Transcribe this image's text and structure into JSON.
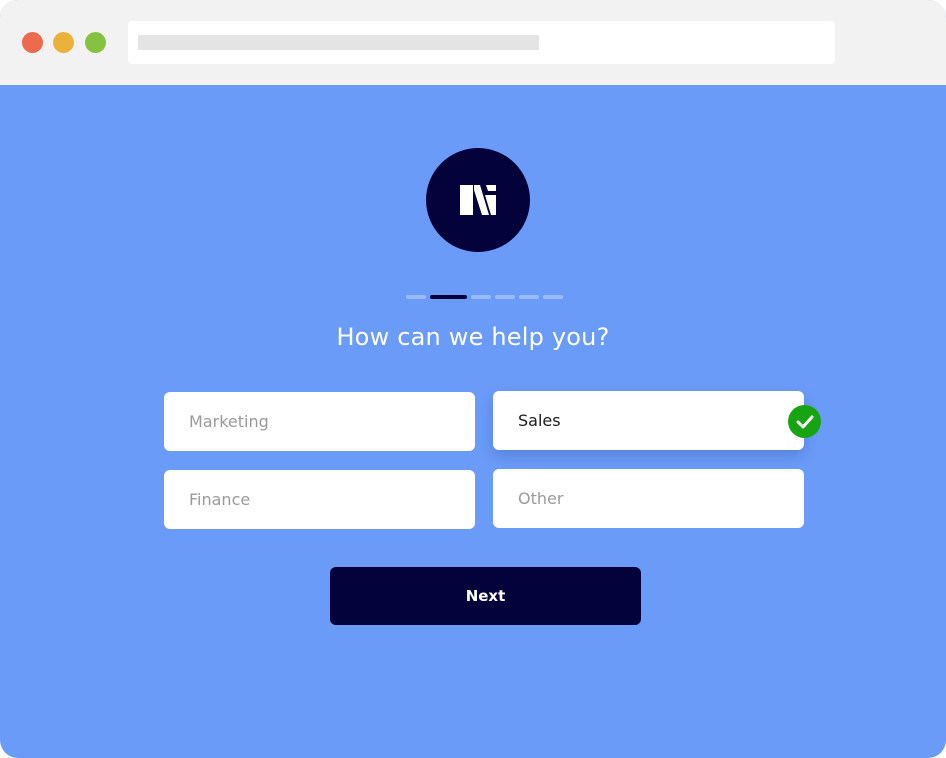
{
  "browser": {
    "controls": [
      "close",
      "minimize",
      "maximize"
    ],
    "address_bar": ""
  },
  "logo": {
    "icon": "n-logo-icon"
  },
  "progress": {
    "total_steps": 6,
    "current_step": 2
  },
  "question": "How can we help you?",
  "options": [
    {
      "label": "Marketing",
      "selected": false
    },
    {
      "label": "Sales",
      "selected": true
    },
    {
      "label": "Finance",
      "selected": false
    },
    {
      "label": "Other",
      "selected": false
    }
  ],
  "next_label": "Next",
  "colors": {
    "background": "#6b9bf8",
    "brand_dark": "#03023a",
    "check_green": "#18a313",
    "titlebar": "#f2f2f2"
  }
}
